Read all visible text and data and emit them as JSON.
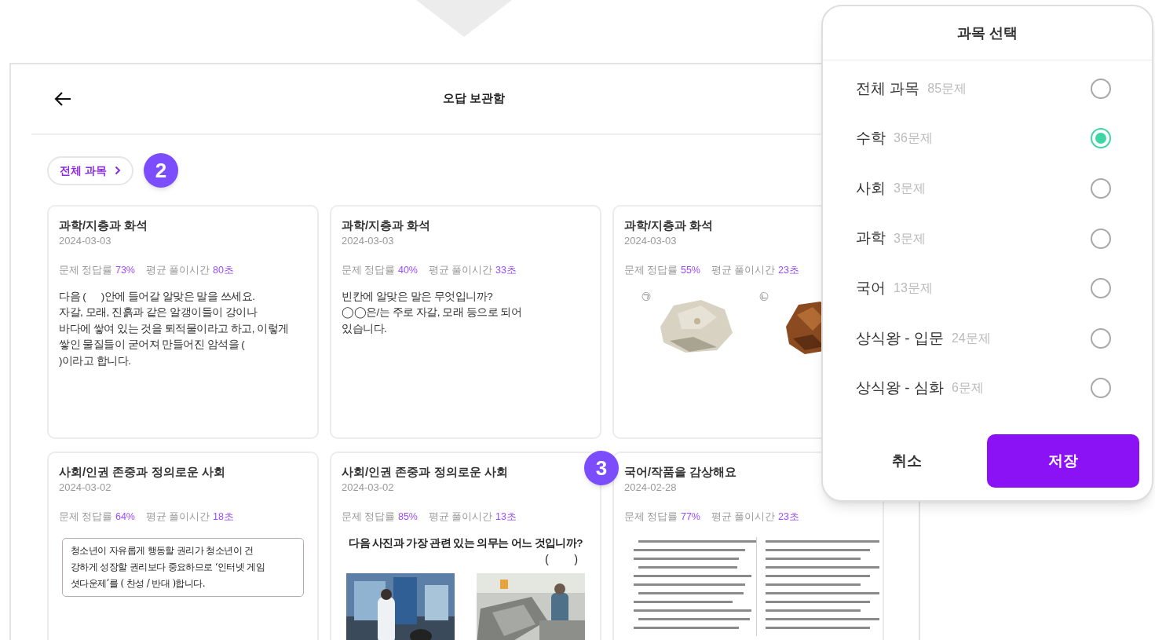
{
  "header": {
    "title": "오답 보관함"
  },
  "filter_chip": {
    "label": "전체 과목"
  },
  "callouts": [
    {
      "label": "2"
    },
    {
      "label": "3"
    }
  ],
  "cards": [
    {
      "kind": "text",
      "title": "과학/지층과 화석",
      "date": "2024-03-03",
      "accuracy_label": "문제 정답률",
      "accuracy": "73%",
      "time_label": "평균 풀이시간",
      "time": "80초",
      "body": "다음 (      )안에 들어갈 알맞은 말을 쓰세요.\n자갈, 모래, 진흙과 같은 알갱이들이 강이나\n바다에 쌓여 있는 것을 퇴적물이라고 하고, 이렇게\n쌓인 물질들이 굳어져 만들어진 암석을 (\n)이라고 합니다."
    },
    {
      "kind": "text",
      "title": "과학/지층과 화석",
      "date": "2024-03-03",
      "accuracy_label": "문제 정답률",
      "accuracy": "40%",
      "time_label": "평균 풀이시간",
      "time": "33초",
      "body": "빈칸에 알맞은 말은 무엇입니까?\n◯◯은/는 주로 자갈, 모래 등으로 되어\n있습니다."
    },
    {
      "kind": "rocks",
      "title": "과학/지층과 화석",
      "date": "2024-03-03",
      "accuracy_label": "문제 정답률",
      "accuracy": "55%",
      "time_label": "평균 풀이시간",
      "time": "23초",
      "markers": [
        "㉠",
        "㉡"
      ]
    },
    {
      "kind": "passage",
      "title": "사회/인권 존중과 정의로운 사회",
      "date": "2024-03-02",
      "accuracy_label": "문제 정답률",
      "accuracy": "64%",
      "time_label": "평균 풀이시간",
      "time": "18초",
      "body": "청소년이 자유롭게 행동할 권리가 청소년이 건\n강하게 성장할 권리보다 중요하므로 ‘인터넷 게임\n셧다운제’를 ( 찬성 / 반대 )합니다."
    },
    {
      "kind": "photos",
      "title": "사회/인권 존중과 정의로운 사회",
      "date": "2024-03-02",
      "accuracy_label": "문제 정답률",
      "accuracy": "85%",
      "time_label": "평균 풀이시간",
      "time": "13초",
      "question": "다음 사진과 가장 관련 있는 의무는 어느 것입니까?",
      "answer_blank": "(        )"
    },
    {
      "kind": "document",
      "title": "국어/작품을 감상해요",
      "date": "2024-02-28",
      "accuracy_label": "문제 정답률",
      "accuracy": "77%",
      "time_label": "평균 풀이시간",
      "time": "23초"
    }
  ],
  "modal": {
    "title": "과목 선택",
    "options": [
      {
        "label": "전체 과목",
        "count": "85문제",
        "selected": false
      },
      {
        "label": "수학",
        "count": "36문제",
        "selected": true
      },
      {
        "label": "사회",
        "count": "3문제",
        "selected": false
      },
      {
        "label": "과학",
        "count": "3문제",
        "selected": false
      },
      {
        "label": "국어",
        "count": "13문제",
        "selected": false
      },
      {
        "label": "상식왕 - 입문",
        "count": "24문제",
        "selected": false
      },
      {
        "label": "상식왕 - 심화",
        "count": "6문제",
        "selected": false
      }
    ],
    "cancel": "취소",
    "save": "저장"
  }
}
